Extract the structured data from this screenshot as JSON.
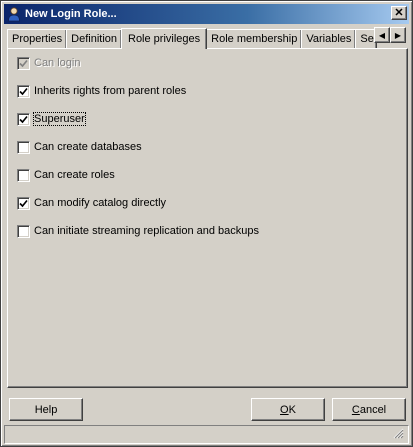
{
  "window": {
    "title": "New Login Role...",
    "close_label": "✕"
  },
  "tabs": [
    {
      "label": "Properties",
      "active": false
    },
    {
      "label": "Definition",
      "active": false
    },
    {
      "label": "Role privileges",
      "active": true
    },
    {
      "label": "Role membership",
      "active": false
    },
    {
      "label": "Variables",
      "active": false
    },
    {
      "label": "Se",
      "active": false
    }
  ],
  "tab_scroll": {
    "left": "◀",
    "right": "▶"
  },
  "privileges": [
    {
      "label": "Can login",
      "checked": true,
      "disabled": true
    },
    {
      "label": "Inherits rights from parent roles",
      "checked": true,
      "disabled": false
    },
    {
      "label": "Superuser",
      "checked": true,
      "disabled": false
    },
    {
      "label": "Can create databases",
      "checked": false,
      "disabled": false
    },
    {
      "label": "Can create roles",
      "checked": false,
      "disabled": false
    },
    {
      "label": "Can modify catalog directly",
      "checked": true,
      "disabled": false
    },
    {
      "label": "Can initiate streaming replication and backups",
      "checked": false,
      "disabled": false
    }
  ],
  "buttons": {
    "help": "Help",
    "ok_mnemonic": "O",
    "ok_rest": "K",
    "cancel_mnemonic": "C",
    "cancel_rest": "ancel"
  },
  "colors": {
    "face": "#d4d0c8",
    "title_start": "#0a246a",
    "title_end": "#a6caf0"
  }
}
